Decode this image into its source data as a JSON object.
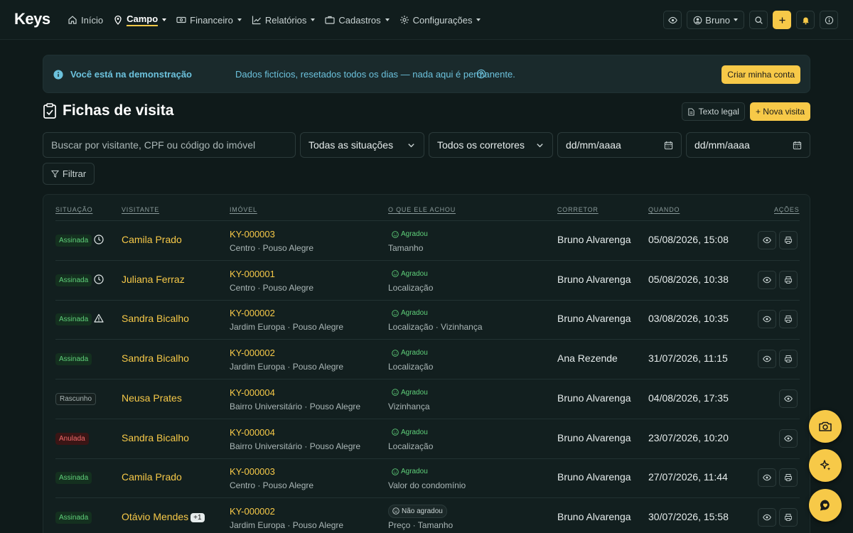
{
  "nav": {
    "brand": "Keys",
    "items": [
      {
        "label": "Início",
        "icon": "home-icon",
        "caret": false,
        "active": false
      },
      {
        "label": "Campo",
        "icon": "pin-icon",
        "caret": true,
        "active": true
      },
      {
        "label": "Financeiro",
        "icon": "money-icon",
        "caret": true,
        "active": false
      },
      {
        "label": "Relatórios",
        "icon": "chart-icon",
        "caret": true,
        "active": false
      },
      {
        "label": "Cadastros",
        "icon": "briefcase-icon",
        "caret": true,
        "active": false
      },
      {
        "label": "Configurações",
        "icon": "gear-icon",
        "caret": true,
        "active": false
      }
    ],
    "user": "Bruno"
  },
  "banner": {
    "title": "Você está na demonstração",
    "text": "Dados fictícios, resetados todos os dias — nada aqui é permanente.",
    "cta": "Criar minha conta"
  },
  "page": {
    "title": "Fichas de visita",
    "legal_btn": "Texto legal",
    "new_btn": "+ Nova visita"
  },
  "filters": {
    "search_placeholder": "Buscar por visitante, CPF ou código do imóvel",
    "status": "Todas as situações",
    "broker": "Todos os corretores",
    "date_from": "dd/mm/aaaa",
    "date_to": "dd/mm/aaaa",
    "filter_btn": "Filtrar"
  },
  "table": {
    "headers": {
      "status": "SITUAÇÃO",
      "visitor": "VISITANTE",
      "property": "IMÓVEL",
      "opinion": "O QUE ELE ACHOU",
      "broker": "CORRETOR",
      "when": "QUANDO",
      "actions": "AÇÕES"
    },
    "rows": [
      {
        "status": "Assinada",
        "status_type": "assinada",
        "status_icon": "clock-icon",
        "visitor": "Camila Prado",
        "extra": "",
        "code": "KY-000003",
        "address": "Centro · Pouso Alegre",
        "opinion": "Agradou",
        "opinion_type": "good",
        "features": "Tamanho",
        "broker": "Bruno Alvarenga",
        "when": "05/08/2026, 15:08",
        "print": true
      },
      {
        "status": "Assinada",
        "status_type": "assinada",
        "status_icon": "clock-icon",
        "visitor": "Juliana Ferraz",
        "extra": "",
        "code": "KY-000001",
        "address": "Centro · Pouso Alegre",
        "opinion": "Agradou",
        "opinion_type": "good",
        "features": "Localização",
        "broker": "Bruno Alvarenga",
        "when": "05/08/2026, 10:38",
        "print": true
      },
      {
        "status": "Assinada",
        "status_type": "assinada",
        "status_icon": "warning-icon",
        "visitor": "Sandra Bicalho",
        "extra": "",
        "code": "KY-000002",
        "address": "Jardim Europa · Pouso Alegre",
        "opinion": "Agradou",
        "opinion_type": "good",
        "features": "Localização · Vizinhança",
        "broker": "Bruno Alvarenga",
        "when": "03/08/2026, 10:35",
        "print": true
      },
      {
        "status": "Assinada",
        "status_type": "assinada",
        "status_icon": "",
        "visitor": "Sandra Bicalho",
        "extra": "",
        "code": "KY-000002",
        "address": "Jardim Europa · Pouso Alegre",
        "opinion": "Agradou",
        "opinion_type": "good",
        "features": "Localização",
        "broker": "Ana Rezende",
        "when": "31/07/2026, 11:15",
        "print": true
      },
      {
        "status": "Rascunho",
        "status_type": "rascunho",
        "status_icon": "",
        "visitor": "Neusa Prates",
        "extra": "",
        "code": "KY-000004",
        "address": "Bairro Universitário · Pouso Alegre",
        "opinion": "Agradou",
        "opinion_type": "good",
        "features": "Vizinhança",
        "broker": "Bruno Alvarenga",
        "when": "04/08/2026, 17:35",
        "print": false
      },
      {
        "status": "Anulada",
        "status_type": "anulada",
        "status_icon": "",
        "visitor": "Sandra Bicalho",
        "extra": "",
        "code": "KY-000004",
        "address": "Bairro Universitário · Pouso Alegre",
        "opinion": "Agradou",
        "opinion_type": "good",
        "features": "Localização",
        "broker": "Bruno Alvarenga",
        "when": "23/07/2026, 10:20",
        "print": false
      },
      {
        "status": "Assinada",
        "status_type": "assinada",
        "status_icon": "",
        "visitor": "Camila Prado",
        "extra": "",
        "code": "KY-000003",
        "address": "Centro · Pouso Alegre",
        "opinion": "Agradou",
        "opinion_type": "good",
        "features": "Valor do condomínio",
        "broker": "Bruno Alvarenga",
        "when": "27/07/2026, 11:44",
        "print": true
      },
      {
        "status": "Assinada",
        "status_type": "assinada",
        "status_icon": "",
        "visitor": "Otávio Mendes",
        "extra": "+1",
        "code": "KY-000002",
        "address": "Jardim Europa · Pouso Alegre",
        "opinion": "Não agradou",
        "opinion_type": "bad",
        "features": "Preço · Tamanho",
        "broker": "Bruno Alvarenga",
        "when": "30/07/2026, 15:58",
        "print": true
      }
    ]
  },
  "colors": {
    "accent": "#f7c948",
    "background": "#0f1a1a",
    "success": "#5fd07a",
    "danger": "#f06a6a",
    "info": "#6cc2dd"
  }
}
